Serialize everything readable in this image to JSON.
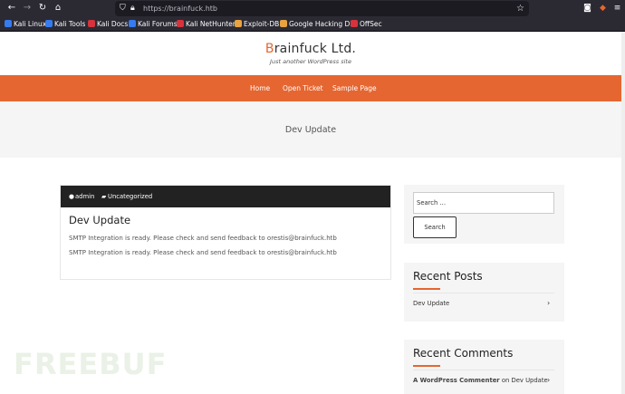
{
  "browser": {
    "url_host": "https://brainfuck.htb",
    "bookmarks": [
      {
        "label": "Kali Linux",
        "color": "#367bf0"
      },
      {
        "label": "Kali Tools",
        "color": "#367bf0"
      },
      {
        "label": "Kali Docs",
        "color": "#d6333d"
      },
      {
        "label": "Kali Forums",
        "color": "#367bf0"
      },
      {
        "label": "Kali NetHunter",
        "color": "#d6333d"
      },
      {
        "label": "Exploit-DB",
        "color": "#e9a33f"
      },
      {
        "label": "Google Hacking DB",
        "color": "#e9a33f"
      },
      {
        "label": "OffSec",
        "color": "#d6333d"
      }
    ]
  },
  "site": {
    "title_first": "B",
    "title_rest": "rainfuck Ltd.",
    "tagline": "Just another WordPress site",
    "accent_color": "#e56631"
  },
  "nav": {
    "items": [
      "Home",
      "Open Ticket",
      "Sample Page"
    ]
  },
  "hero": {
    "title": "Dev Update"
  },
  "post": {
    "author": "admin",
    "category": "Uncategorized",
    "title": "Dev Update",
    "lines": [
      "SMTP Integration is ready. Please check and send feedback to orestis@brainfuck.htb",
      "SMTP Integration is ready. Please check and send feedback to orestis@brainfuck.htb"
    ]
  },
  "sidebar": {
    "search_placeholder": "Search ...",
    "search_button": "Search",
    "recent_posts_title": "Recent Posts",
    "recent_posts": [
      "Dev Update"
    ],
    "recent_comments_title": "Recent Comments",
    "recent_comment": {
      "author": "A WordPress Commenter",
      "on": "on",
      "post": "Dev Update"
    }
  },
  "watermark": "FREEBUF"
}
